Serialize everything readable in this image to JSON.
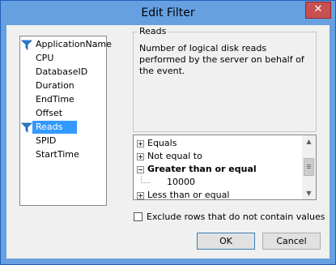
{
  "window": {
    "title": "Edit Filter",
    "close_glyph": "✕"
  },
  "columns": {
    "items": [
      "ApplicationName",
      "CPU",
      "DatabaseID",
      "Duration",
      "EndTime",
      "Offset",
      "Reads",
      "SPID",
      "StartTime"
    ],
    "filtered": [
      "ApplicationName",
      "Reads"
    ],
    "selected": "Reads"
  },
  "description": {
    "title": "Reads",
    "text": "Number of logical disk reads performed by the server on behalf of the event."
  },
  "operators": {
    "items": [
      {
        "label": "Equals",
        "expanded": false,
        "bold": false
      },
      {
        "label": "Not equal to",
        "expanded": false,
        "bold": false
      },
      {
        "label": "Greater than or equal",
        "expanded": true,
        "bold": true
      },
      {
        "label": "Less than or equal",
        "expanded": false,
        "bold": false
      }
    ],
    "value": "10000"
  },
  "exclude": {
    "label": "Exclude rows that do not contain values",
    "checked": false
  },
  "buttons": {
    "ok": "OK",
    "cancel": "Cancel"
  },
  "colors": {
    "titlebar": "#66a0e1",
    "selection": "#3399ff",
    "close": "#c75050",
    "funnel": "#2b7bd3"
  },
  "icons": {
    "filter": "funnel-icon",
    "close": "close-icon"
  }
}
